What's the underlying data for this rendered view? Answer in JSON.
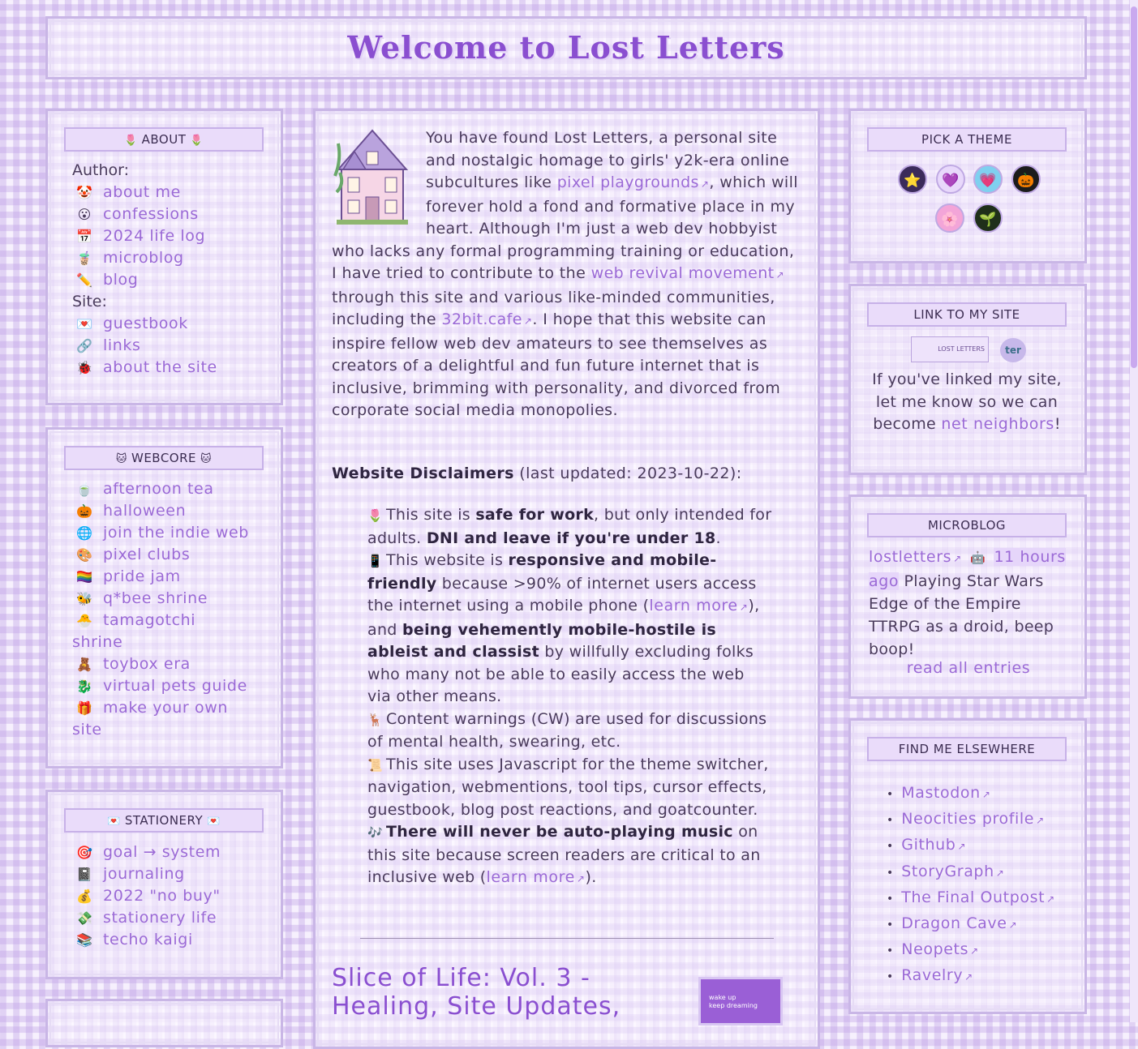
{
  "site": {
    "title": "Welcome to Lost Letters"
  },
  "about": {
    "header": "ABOUT",
    "author_label": "Author:",
    "author_items": [
      {
        "icon": "face-icon",
        "glyph": "🤡",
        "label": "about me"
      },
      {
        "icon": "smiley-icon",
        "glyph": "😮",
        "label": "confessions"
      },
      {
        "icon": "calendar-icon",
        "glyph": "📅",
        "label": "2024 life log"
      },
      {
        "icon": "bubble-tea-icon",
        "glyph": "🧋",
        "label": "microblog"
      },
      {
        "icon": "pencil-icon",
        "glyph": "✏️",
        "label": "blog"
      }
    ],
    "site_label": "Site:",
    "site_items": [
      {
        "icon": "heart-letter-icon",
        "glyph": "💌",
        "label": "guestbook"
      },
      {
        "icon": "chain-link-icon",
        "glyph": "🔗",
        "label": "links"
      },
      {
        "icon": "bug-icon",
        "glyph": "🐞",
        "label": "about the site"
      }
    ]
  },
  "webcore": {
    "header": "WEBCORE",
    "items": [
      {
        "icon": "teacup-icon",
        "glyph": "🍵",
        "label": "afternoon tea"
      },
      {
        "icon": "pumpkin-icon",
        "glyph": "🎃",
        "label": "halloween"
      },
      {
        "icon": "globe-icon",
        "glyph": "🌐",
        "label": "join the indie web"
      },
      {
        "icon": "palette-icon",
        "glyph": "🎨",
        "label": "pixel clubs"
      },
      {
        "icon": "rainbow-flag-icon",
        "glyph": "🏳️‍🌈",
        "label": "pride jam"
      },
      {
        "icon": "bee-icon",
        "glyph": "🐝",
        "label": "q*bee shrine"
      },
      {
        "icon": "chick-icon",
        "glyph": "🐣",
        "label": "tamagotchi",
        "cont": "shrine"
      },
      {
        "icon": "teddy-bear-icon",
        "glyph": "🧸",
        "label": "toybox era"
      },
      {
        "icon": "dragon-icon",
        "glyph": "🐉",
        "label": "virtual pets guide"
      },
      {
        "icon": "gift-icon",
        "glyph": "🎁",
        "label": "make your own",
        "cont": "site"
      }
    ]
  },
  "stationery": {
    "header": "STATIONERY",
    "items": [
      {
        "icon": "target-icon",
        "glyph": "🎯",
        "label": "goal → system"
      },
      {
        "icon": "notebook-icon",
        "glyph": "📓",
        "label": "journaling"
      },
      {
        "icon": "money-bag-icon",
        "glyph": "💰",
        "label": "2022 \"no buy\""
      },
      {
        "icon": "money-icon",
        "glyph": "💸",
        "label": "stationery life"
      },
      {
        "icon": "books-icon",
        "glyph": "📚",
        "label": "techo kaigi"
      }
    ]
  },
  "intro": {
    "p1a": "You have found Lost Letters, a personal site and nostalgic homage to girls' y2k-era online subcultures like ",
    "link1": "pixel playgrounds",
    "p1b": ", which will forever hold a fond and formative place in my heart. Although I'm just a web dev hobbyist who lacks any formal programming training or education, I have tried to contribute to the ",
    "link2": "web revival movement",
    "p1c": " through this site and various like-minded communities, including the ",
    "link3": "32bit.cafe",
    "p1d": ". I hope that this website can inspire fellow web dev amateurs to see themselves as creators of a delightful and fun future internet that is inclusive, brimming with personality, and divorced from corporate social media monopolies."
  },
  "disclaimers": {
    "heading": "Website Disclaimers",
    "updated": "(last updated: 2023-10-22):",
    "d1": {
      "icon": "tulip-icon",
      "glyph": "🌷",
      "a": "This site is ",
      "b1": "safe for work",
      "c": ", but only intended for adults. ",
      "b2": "DNI and leave if you're under 18",
      "d": "."
    },
    "d2": {
      "icon": "phone-icon",
      "glyph": "📱",
      "a": "This website is ",
      "b1": "responsive and mobile-friendly",
      "c": " because >90% of internet users access the internet using a mobile phone (",
      "link": "learn more",
      "d": "), and ",
      "b2": "being vehemently mobile-hostile is ableist and classist",
      "e": " by willfully excluding folks who many not be able to easily access the web via other means."
    },
    "d3": {
      "icon": "deer-icon",
      "glyph": "🦌",
      "text": "Content warnings (CW) are used for discussions of mental health, swearing, etc."
    },
    "d4": {
      "icon": "script-icon",
      "glyph": "📜",
      "text": "This site uses Javascript for the theme switcher, navigation, webmentions, tool tips, cursor effects, guestbook, blog post reactions, and goatcounter."
    },
    "d5": {
      "icon": "music-icon",
      "glyph": "🎶",
      "b": "There will never be auto-playing music",
      "a": " on this site because screen readers are critical to an inclusive web (",
      "link": "learn more",
      "c": ")."
    }
  },
  "post": {
    "title_line1": "Slice of Life: Vol. 3 -",
    "title_line2": "Healing, Site Updates,",
    "badge_line1": "wake up",
    "badge_line2": "keep dreaming"
  },
  "theme": {
    "header": "PICK A THEME",
    "buttons": [
      {
        "icon": "star-theme-icon",
        "glyph": "⭐",
        "bg": "#3b2b5a"
      },
      {
        "icon": "purple-heart-theme-icon",
        "glyph": "💜",
        "bg": "#e8d8fb"
      },
      {
        "icon": "heart-theme-icon",
        "glyph": "💗",
        "bg": "#7fd0ef"
      },
      {
        "icon": "pumpkin-theme-icon",
        "glyph": "🎃",
        "bg": "#1c1c1c"
      },
      {
        "icon": "flower-theme-icon",
        "glyph": "🌸",
        "bg": "#f3a5d8"
      },
      {
        "icon": "sprout-theme-icon",
        "glyph": "🌱",
        "bg": "#1f2f1a"
      }
    ]
  },
  "linkto": {
    "header": "LINK TO MY SITE",
    "button1_text": "LOST LETTERS",
    "button2_text": "ter",
    "text_a": "If you've linked my site, let me know so we can become ",
    "text_link": "net neighbors",
    "text_b": "!"
  },
  "microblog": {
    "header": "MICROBLOG",
    "user": "lostletters",
    "time": "11 hours ago",
    "text": "Playing Star Wars Edge of the Empire TTRPG as a droid, beep boop!",
    "more": "read all entries"
  },
  "elsewhere": {
    "header": "FIND ME ELSEWHERE",
    "items": [
      "Mastodon",
      "Neocities profile",
      "Github",
      "StoryGraph",
      "The Final Outpost",
      "Dragon Cave",
      "Neopets",
      "Ravelry"
    ]
  }
}
